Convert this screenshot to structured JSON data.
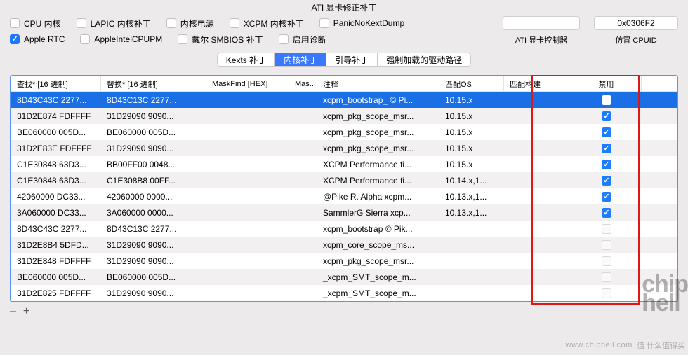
{
  "top_title": "ATI 显卡修正补丁",
  "checkboxes_row1": [
    {
      "name": "cpu-core",
      "label": "CPU 内核",
      "checked": false
    },
    {
      "name": "lapic",
      "label": "LAPIC 内核补丁",
      "checked": false
    },
    {
      "name": "kernel-pm",
      "label": "内核电源",
      "checked": false
    },
    {
      "name": "xcpm",
      "label": "XCPM 内核补丁",
      "checked": false
    },
    {
      "name": "panic-nokext",
      "label": "PanicNoKextDump",
      "checked": false
    }
  ],
  "checkboxes_row2": [
    {
      "name": "apple-rtc",
      "label": "Apple RTC",
      "checked": true
    },
    {
      "name": "apple-intel-pm",
      "label": "AppleIntelCPUPM",
      "checked": false
    },
    {
      "name": "dell-smbios",
      "label": "戴尔 SMBIOS 补丁",
      "checked": false
    },
    {
      "name": "enable-diag",
      "label": "启用诊断",
      "checked": false
    }
  ],
  "right_fields": {
    "ati_controller": {
      "value": "",
      "caption": "ATI 显卡控制器"
    },
    "fake_cpuid": {
      "value": "0x0306F2",
      "caption": "仿冒 CPUID"
    }
  },
  "tabs": [
    {
      "name": "kexts",
      "label": "Kexts 补丁",
      "active": false
    },
    {
      "name": "kernel",
      "label": "内核补丁",
      "active": true
    },
    {
      "name": "boot",
      "label": "引导补丁",
      "active": false
    },
    {
      "name": "forced",
      "label": "强制加载的驱动路径",
      "active": false
    }
  ],
  "columns": {
    "find": "查找* [16 进制]",
    "replace": "替换* [16 进制]",
    "maskf": "MaskFind [HEX]",
    "maskr": "Mas...",
    "comment": "注释",
    "matchos": "匹配OS",
    "matchbuild": "匹配构建",
    "disabled": "禁用"
  },
  "rows": [
    {
      "find": "8D43C43C 2277...",
      "repl": "8D43C13C 2277...",
      "maskf": "",
      "maskr": "",
      "comment": "xcpm_bootstrap_ © Pi...",
      "os": "10.15.x",
      "build": "",
      "disabled": false,
      "selected": true
    },
    {
      "find": "31D2E874 FDFFFF",
      "repl": "31D29090 9090...",
      "maskf": "",
      "maskr": "",
      "comment": "xcpm_pkg_scope_msr...",
      "os": "10.15.x",
      "build": "",
      "disabled": true,
      "selected": false
    },
    {
      "find": "BE060000 005D...",
      "repl": "BE060000 005D...",
      "maskf": "",
      "maskr": "",
      "comment": "xcpm_pkg_scope_msr...",
      "os": "10.15.x",
      "build": "",
      "disabled": true,
      "selected": false
    },
    {
      "find": "31D2E83E FDFFFF",
      "repl": "31D29090 9090...",
      "maskf": "",
      "maskr": "",
      "comment": "xcpm_pkg_scope_msr...",
      "os": "10.15.x",
      "build": "",
      "disabled": true,
      "selected": false
    },
    {
      "find": "C1E30848 63D3...",
      "repl": "BB00FF00 0048...",
      "maskf": "",
      "maskr": "",
      "comment": "XCPM Performance fi...",
      "os": "10.15.x",
      "build": "",
      "disabled": true,
      "selected": false
    },
    {
      "find": "C1E30848 63D3...",
      "repl": "C1E308B8 00FF...",
      "maskf": "",
      "maskr": "",
      "comment": "XCPM Performance fi...",
      "os": "10.14.x,1...",
      "build": "",
      "disabled": true,
      "selected": false
    },
    {
      "find": "42060000 DC33...",
      "repl": "42060000 0000...",
      "maskf": "",
      "maskr": "",
      "comment": "@Pike R. Alpha xcpm...",
      "os": "10.13.x,1...",
      "build": "",
      "disabled": true,
      "selected": false
    },
    {
      "find": "3A060000 DC33...",
      "repl": "3A060000 0000...",
      "maskf": "",
      "maskr": "",
      "comment": "SammlerG Sierra xcp...",
      "os": "10.13.x,1...",
      "build": "",
      "disabled": true,
      "selected": false
    },
    {
      "find": "8D43C43C 2277...",
      "repl": "8D43C13C 2277...",
      "maskf": "",
      "maskr": "",
      "comment": "xcpm_bootstrap © Pik...",
      "os": "",
      "build": "",
      "disabled": false,
      "selected": false
    },
    {
      "find": "31D2E8B4 5DFD...",
      "repl": "31D29090 9090...",
      "maskf": "",
      "maskr": "",
      "comment": "xcpm_core_scope_ms...",
      "os": "",
      "build": "",
      "disabled": false,
      "selected": false
    },
    {
      "find": "31D2E848 FDFFFF",
      "repl": "31D29090 9090...",
      "maskf": "",
      "maskr": "",
      "comment": "xcpm_pkg_scope_msr...",
      "os": "",
      "build": "",
      "disabled": false,
      "selected": false
    },
    {
      "find": "BE060000 005D...",
      "repl": "BE060000 005D...",
      "maskf": "",
      "maskr": "",
      "comment": "_xcpm_SMT_scope_m...",
      "os": "",
      "build": "",
      "disabled": false,
      "selected": false
    },
    {
      "find": "31D2E825 FDFFFF",
      "repl": "31D29090 9090...",
      "maskf": "",
      "maskr": "",
      "comment": "_xcpm_SMT_scope_m...",
      "os": "",
      "build": "",
      "disabled": false,
      "selected": false
    }
  ],
  "footer": {
    "minus": "–",
    "plus": "+"
  },
  "watermark_url": "www.chiphell.com"
}
